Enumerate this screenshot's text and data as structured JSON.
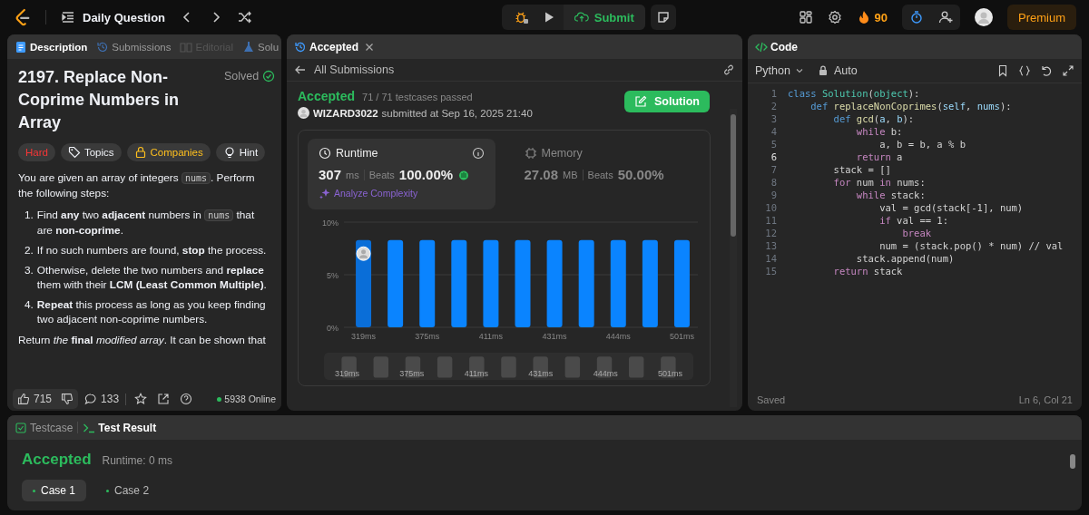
{
  "top_bar": {
    "problem_list": "Daily Question",
    "submit": "Submit",
    "streak": "90",
    "premium": "Premium"
  },
  "description_panel": {
    "tabs": [
      {
        "label": "Description",
        "kind": "description",
        "selected": true,
        "disabled": false
      },
      {
        "label": "Submissions",
        "kind": "submissions",
        "selected": false,
        "disabled": false
      },
      {
        "label": "Editorial",
        "kind": "editorial",
        "selected": false,
        "disabled": true
      },
      {
        "label": "Solu",
        "kind": "solutions",
        "selected": false,
        "disabled": false
      }
    ],
    "title": "2197. Replace Non-Coprime Numbers in Array",
    "status": "Solved",
    "tags": [
      {
        "label": "Hard",
        "kind": "difficulty",
        "color": "#f63636"
      },
      {
        "label": "Topics",
        "kind": "topics",
        "color": "#eff1f6"
      },
      {
        "label": "Companies",
        "kind": "companies",
        "color": "#ffc01e"
      },
      {
        "label": "Hint",
        "kind": "hint",
        "color": "#eff1f6"
      }
    ],
    "intro": [
      {
        "text": "You are given an array of integers ",
        "kind": "text"
      },
      {
        "text": "nums",
        "kind": "code"
      },
      {
        "text": ". Perform the following steps:",
        "kind": "text"
      }
    ],
    "steps": [
      {
        "marker": "1.",
        "parts": [
          {
            "text": "Find **any** two **adjacent** numbers in ",
            "kind": "text"
          },
          {
            "text": "nums",
            "kind": "code"
          },
          {
            "text": " that are **non-coprime**.",
            "kind": "text"
          }
        ]
      },
      {
        "marker": "2.",
        "parts": [
          {
            "text": "If no such numbers are found, **stop** the process.",
            "kind": "text"
          }
        ]
      },
      {
        "marker": "3.",
        "parts": [
          {
            "text": "Otherwise, delete the two numbers and **replace** them with their **LCM (Least Common Multiple)**.",
            "kind": "text"
          }
        ]
      },
      {
        "marker": "4.",
        "parts": [
          {
            "text": "**Repeat** this process as long as you keep finding two adjacent non-coprime numbers.",
            "kind": "text"
          }
        ]
      }
    ],
    "last_line": "Return *the* **final** *modified array*. It can be shown that",
    "footer": {
      "likes": "715",
      "comments": "133",
      "online": "5938 Online"
    }
  },
  "submission_panel": {
    "tab": "Accepted",
    "back_link": "All Submissions",
    "result": "Accepted",
    "testcases": "71 / 71 testcases passed",
    "user": "WIZARD3022",
    "submitted": "submitted at Sep 16, 2025 21:40",
    "solution_button": "Solution",
    "stats": [
      {
        "kind": "runtime",
        "label": "Runtime",
        "value": "307",
        "unit": "ms",
        "beats_label": "Beats",
        "beats": "100.00%",
        "selected": true
      },
      {
        "kind": "memory",
        "label": "Memory",
        "value": "27.08",
        "unit": "MB",
        "beats_label": "Beats",
        "beats": "50.00%",
        "selected": false
      }
    ],
    "analyze": "Analyze Complexity",
    "chart_data": {
      "type": "bar",
      "categories": [
        "319ms",
        null,
        "375ms",
        null,
        "411ms",
        null,
        "431ms",
        null,
        "444ms",
        null,
        "501ms"
      ],
      "values": [
        8.3,
        8.3,
        8.3,
        8.3,
        8.3,
        8.3,
        8.3,
        8.3,
        8.3,
        8.3,
        8.3
      ],
      "ylim": [
        0,
        10
      ],
      "yticks": [
        {
          "value": 0,
          "label": "0%"
        },
        {
          "value": 5,
          "label": "5%"
        },
        {
          "value": 10,
          "label": "10%"
        }
      ]
    },
    "range_labels": [
      "319ms",
      "375ms",
      "411ms",
      "431ms",
      "444ms",
      "501ms"
    ]
  },
  "code_panel": {
    "title": "Code",
    "language": "Python",
    "mode": "Auto",
    "lines": [
      {
        "number": "1",
        "current": false,
        "tokens": [
          {
            "text": "class ",
            "kind": "kw"
          },
          {
            "text": "Solution",
            "kind": "cls"
          },
          {
            "text": "(",
            "kind": "p"
          },
          {
            "text": "object",
            "kind": "cls"
          },
          {
            "text": "):",
            "kind": "p"
          }
        ]
      },
      {
        "number": "2",
        "current": false,
        "tokens": [
          {
            "text": "    def ",
            "kind": "kw"
          },
          {
            "text": "replaceNonCoprimes",
            "kind": "fn"
          },
          {
            "text": "(",
            "kind": "p"
          },
          {
            "text": "self",
            "kind": "var"
          },
          {
            "text": ", ",
            "kind": "p"
          },
          {
            "text": "nums",
            "kind": "var"
          },
          {
            "text": "):",
            "kind": "p"
          }
        ]
      },
      {
        "number": "3",
        "current": false,
        "tokens": [
          {
            "text": "        def ",
            "kind": "kw"
          },
          {
            "text": "gcd",
            "kind": "fn"
          },
          {
            "text": "(",
            "kind": "p"
          },
          {
            "text": "a",
            "kind": "var"
          },
          {
            "text": ", ",
            "kind": "p"
          },
          {
            "text": "b",
            "kind": "var"
          },
          {
            "text": "):",
            "kind": "p"
          }
        ]
      },
      {
        "number": "4",
        "current": false,
        "tokens": [
          {
            "text": "            while ",
            "kind": "ctl"
          },
          {
            "text": "b:",
            "kind": "p"
          }
        ]
      },
      {
        "number": "5",
        "current": false,
        "tokens": [
          {
            "text": "                a, b = b, a % b",
            "kind": "p"
          }
        ]
      },
      {
        "number": "6",
        "current": true,
        "tokens": [
          {
            "text": "            return ",
            "kind": "ctl"
          },
          {
            "text": "a",
            "kind": "p"
          }
        ]
      },
      {
        "number": "7",
        "current": false,
        "tokens": [
          {
            "text": "        stack = []",
            "kind": "p"
          }
        ]
      },
      {
        "number": "8",
        "current": false,
        "tokens": [
          {
            "text": "        for ",
            "kind": "ctl"
          },
          {
            "text": "num ",
            "kind": "p"
          },
          {
            "text": "in ",
            "kind": "ctl"
          },
          {
            "text": "nums:",
            "kind": "p"
          }
        ]
      },
      {
        "number": "9",
        "current": false,
        "tokens": [
          {
            "text": "            while ",
            "kind": "ctl"
          },
          {
            "text": "stack:",
            "kind": "p"
          }
        ]
      },
      {
        "number": "10",
        "current": false,
        "tokens": [
          {
            "text": "                val = gcd(stack[-1], num)",
            "kind": "p"
          }
        ]
      },
      {
        "number": "11",
        "current": false,
        "tokens": [
          {
            "text": "                if ",
            "kind": "ctl"
          },
          {
            "text": "val == 1:",
            "kind": "p"
          }
        ]
      },
      {
        "number": "12",
        "current": false,
        "tokens": [
          {
            "text": "                    break",
            "kind": "ctl"
          }
        ]
      },
      {
        "number": "13",
        "current": false,
        "tokens": [
          {
            "text": "                num = (stack.pop() * num) // val",
            "kind": "p"
          }
        ]
      },
      {
        "number": "14",
        "current": false,
        "tokens": [
          {
            "text": "            stack.append(num)",
            "kind": "p"
          }
        ]
      },
      {
        "number": "15",
        "current": false,
        "tokens": [
          {
            "text": "        return ",
            "kind": "ctl"
          },
          {
            "text": "stack",
            "kind": "p"
          }
        ]
      }
    ],
    "status": "Saved",
    "cursor": "Ln 6, Col 21"
  },
  "console_panel": {
    "tabs": [
      {
        "label": "Testcase",
        "kind": "testcase",
        "selected": false
      },
      {
        "label": "Test Result",
        "kind": "result",
        "selected": true
      }
    ],
    "result": "Accepted",
    "runtime": "Runtime: 0 ms",
    "cases": [
      {
        "label": "Case 1",
        "selected": true
      },
      {
        "label": "Case 2",
        "selected": false
      }
    ]
  }
}
